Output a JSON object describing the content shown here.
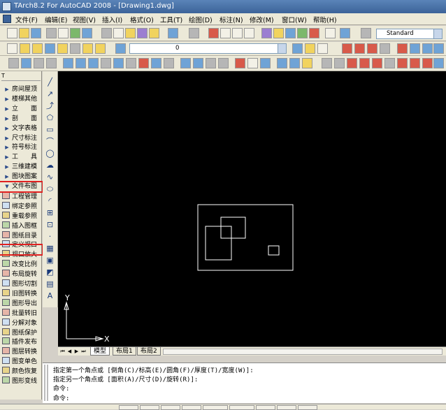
{
  "window": {
    "title": "TArch8.2 For AutoCAD 2008 - [Drawing1.dwg]"
  },
  "menu": [
    "文件(F)",
    "编辑(E)",
    "视图(V)",
    "插入(I)",
    "格式(O)",
    "工具(T)",
    "绘图(D)",
    "标注(N)",
    "修改(M)",
    "窗口(W)",
    "帮助(H)"
  ],
  "toolbar": {
    "text_style": "Standard",
    "layer": "0"
  },
  "sidebar": {
    "header": "T",
    "items": [
      {
        "label": "房间屋顶",
        "kind": "arrow"
      },
      {
        "label": "楼梯其他",
        "kind": "arrow"
      },
      {
        "label": "立　　面",
        "kind": "arrow"
      },
      {
        "label": "剖　　面",
        "kind": "arrow"
      },
      {
        "label": "文字表格",
        "kind": "arrow"
      },
      {
        "label": "尺寸标注",
        "kind": "arrow"
      },
      {
        "label": "符号标注",
        "kind": "arrow"
      },
      {
        "label": "工　　具",
        "kind": "arrow"
      },
      {
        "label": "三维建模",
        "kind": "arrow"
      },
      {
        "label": "图块图案",
        "kind": "arrow"
      },
      {
        "label": "文件布图",
        "kind": "expanded"
      },
      {
        "label": "工程管理",
        "kind": "icon"
      },
      {
        "label": "绑定参照",
        "kind": "icon"
      },
      {
        "label": "重载参照",
        "kind": "icon"
      },
      {
        "label": "插入图框",
        "kind": "icon"
      },
      {
        "label": "图纸目录",
        "kind": "icon"
      },
      {
        "label": "定义视口",
        "kind": "icon"
      },
      {
        "label": "视口放大",
        "kind": "icon"
      },
      {
        "label": "改变比例",
        "kind": "icon"
      },
      {
        "label": "布局旋转",
        "kind": "icon"
      },
      {
        "label": "图形切割",
        "kind": "icon"
      },
      {
        "label": "旧图转换",
        "kind": "icon"
      },
      {
        "label": "图形导出",
        "kind": "icon"
      },
      {
        "label": "批量转旧",
        "kind": "icon"
      },
      {
        "label": "分解对象",
        "kind": "icon"
      },
      {
        "label": "图纸保护",
        "kind": "icon"
      },
      {
        "label": "插件发布",
        "kind": "icon"
      },
      {
        "label": "图层转换",
        "kind": "icon"
      },
      {
        "label": "图变单色",
        "kind": "icon"
      },
      {
        "label": "颜色恢复",
        "kind": "icon"
      },
      {
        "label": "图形变线",
        "kind": "icon"
      }
    ]
  },
  "highlights": [
    "文件布图",
    "定义视口"
  ],
  "canvas": {
    "ucs_x": "X",
    "ucs_y": "Y"
  },
  "layout_tabs": [
    "模型",
    "布局1",
    "布局2"
  ],
  "command_lines": [
    "指定第一个角点或 [倒角(C)/标高(E)/圆角(F)/厚度(T)/宽度(W)]:",
    "指定另一个角点或 [面积(A)/尺寸(D)/旋转(R)]:",
    "命令:",
    "命令:"
  ],
  "colors": {
    "title_bar": "#3c6399",
    "canvas_bg": "#000000",
    "highlight": "#e02020"
  }
}
